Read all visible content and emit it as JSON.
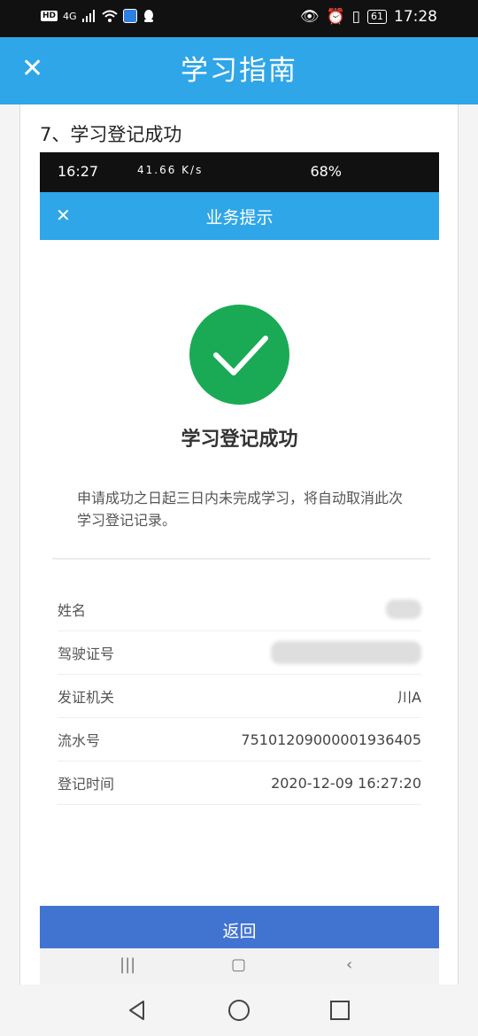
{
  "status_bar": {
    "left_text": "4G",
    "right_battery": "61",
    "time": "17:28"
  },
  "header": {
    "title": "学习指南",
    "close_icon": "close-icon"
  },
  "guide": {
    "step_title": "7、学习登记成功"
  },
  "inner_status": {
    "time": "16:27",
    "middle": "41.66 K/s",
    "battery": "68%"
  },
  "inner_header": {
    "title": "业务提示"
  },
  "result": {
    "title": "学习登记成功",
    "notice": "申请成功之日起三日内未完成学习，将自动取消此次学习登记记录。"
  },
  "info": [
    {
      "label": "姓名",
      "value": ""
    },
    {
      "label": "驾驶证号",
      "value": ""
    },
    {
      "label": "发证机关",
      "value": "川A"
    },
    {
      "label": "流水号",
      "value": "75101209000001936405"
    },
    {
      "label": "登记时间",
      "value": "2020-12-09 16:27:20"
    }
  ],
  "return_button": "返回",
  "colors": {
    "header_blue": "#2fa6e8",
    "success_green": "#1aaa55",
    "button_blue": "#4173d1"
  }
}
